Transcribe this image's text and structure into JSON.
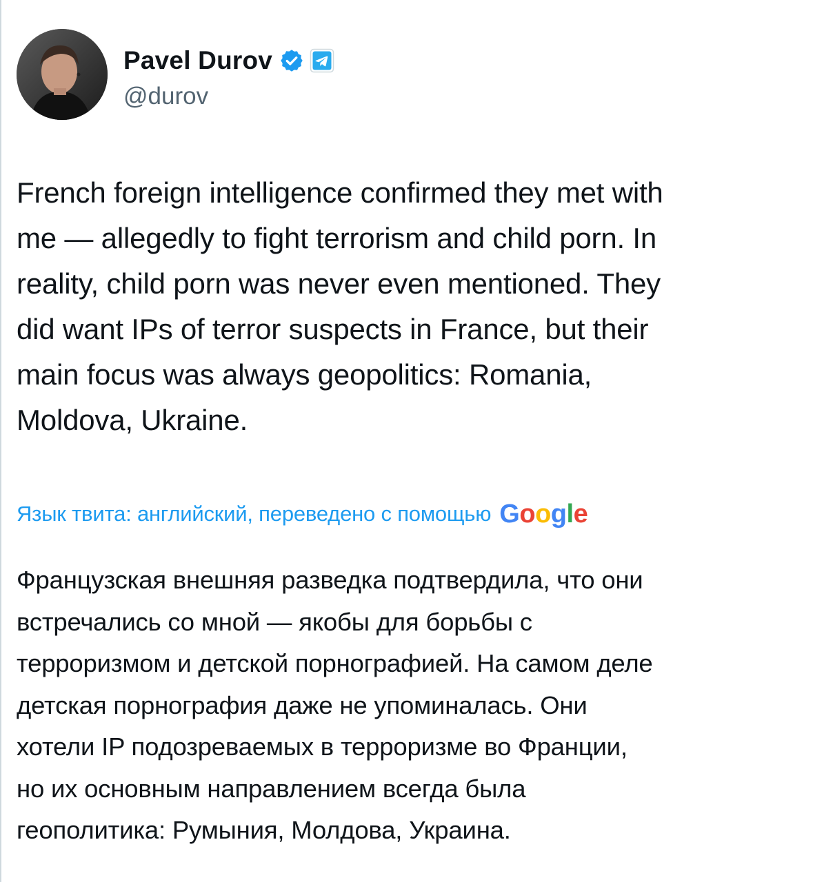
{
  "author": {
    "display_name": "Pavel Durov",
    "handle": "@durov",
    "verified_icon": "verified-badge-icon",
    "affiliate_icon": "telegram-icon",
    "accent_color": "#1d9bf0"
  },
  "tweet": {
    "text": "French foreign intelligence confirmed they met with\nme — allegedly to fight terrorism and child porn. In\nreality, child porn was never even mentioned. They\ndid want IPs of terror suspects in France, but their\nmain focus was always geopolitics: Romania,\nMoldova, Ukraine."
  },
  "translation": {
    "label": "Язык твита: английский, переведено с помощью",
    "provider_letters": [
      "G",
      "o",
      "o",
      "g",
      "l",
      "e"
    ],
    "text": "Французская внешняя разведка подтвердила, что они\nвстречались со мной — якобы для борьбы с\nтерроризмом и детской порнографией. На самом деле\nдетская порнография даже не упоминалась. Они\nхотели IP подозреваемых в терроризме во Франции,\nно их основным направлением всегда была\nгеополитика: Румыния, Молдова, Украина."
  }
}
